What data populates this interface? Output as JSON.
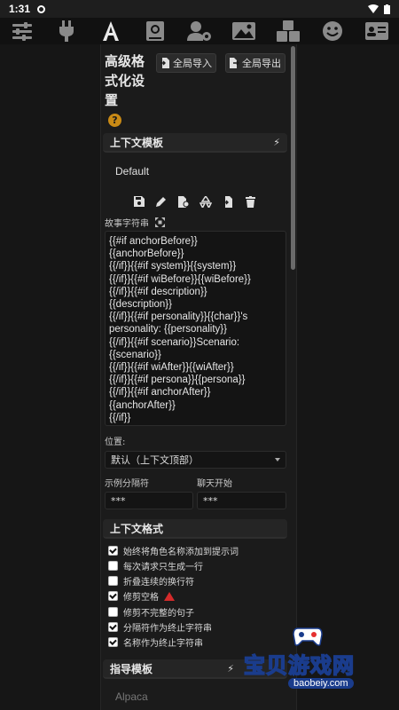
{
  "status": {
    "time": "1:31"
  },
  "toolbar": {
    "icons": [
      "sliders-icon",
      "plug-icon",
      "font-a-icon",
      "book-globe-icon",
      "user-gear-icon",
      "image-icon",
      "cubes-icon",
      "smile-icon",
      "id-card-icon"
    ]
  },
  "panel": {
    "title": "高级格式化设置",
    "import_label": "全局导入",
    "export_label": "全局导出",
    "context_template": {
      "header": "上下文模板",
      "preset": "Default",
      "story_string_label": "故事字符串",
      "story_string": "{{#if anchorBefore}}\n{{anchorBefore}}\n{{/if}}{{#if system}}{{system}}\n{{/if}}{{#if wiBefore}}{{wiBefore}}\n{{/if}}{{#if description}}\n{{description}}\n{{/if}}{{#if personality}}{{char}}'s\npersonality: {{personality}}\n{{/if}}{{#if scenario}}Scenario:\n{{scenario}}\n{{/if}}{{#if wiAfter}}{{wiAfter}}\n{{/if}}{{#if persona}}{{persona}}\n{{/if}}{{#if anchorAfter}}\n{{anchorAfter}}\n{{/if}}",
      "position_label": "位置:",
      "position_value": "默认（上下文顶部）",
      "example_separator_label": "示例分隔符",
      "example_separator_value": "***",
      "chat_start_label": "聊天开始",
      "chat_start_value": "***"
    },
    "context_formatting": {
      "header": "上下文格式",
      "options": [
        {
          "label": "始终将角色名称添加到提示词",
          "checked": true
        },
        {
          "label": "每次请求只生成一行",
          "checked": false
        },
        {
          "label": "折叠连续的换行符",
          "checked": false
        },
        {
          "label": "修剪空格",
          "checked": true
        },
        {
          "label": "修剪不完整的句子",
          "checked": false
        },
        {
          "label": "分隔符作为终止字符串",
          "checked": true
        },
        {
          "label": "名称作为终止字符串",
          "checked": true
        }
      ]
    },
    "instruct_template": {
      "header": "指导模板",
      "preset": "Alpaca"
    }
  },
  "watermark": {
    "text": "宝贝游戏网",
    "url": "baobeiy.com"
  },
  "colors": {
    "accent_warn": "#d42b2b",
    "help": "#c98a15",
    "watermark_yellow": "#ffe02a",
    "watermark_blue": "#1a3c8c"
  }
}
